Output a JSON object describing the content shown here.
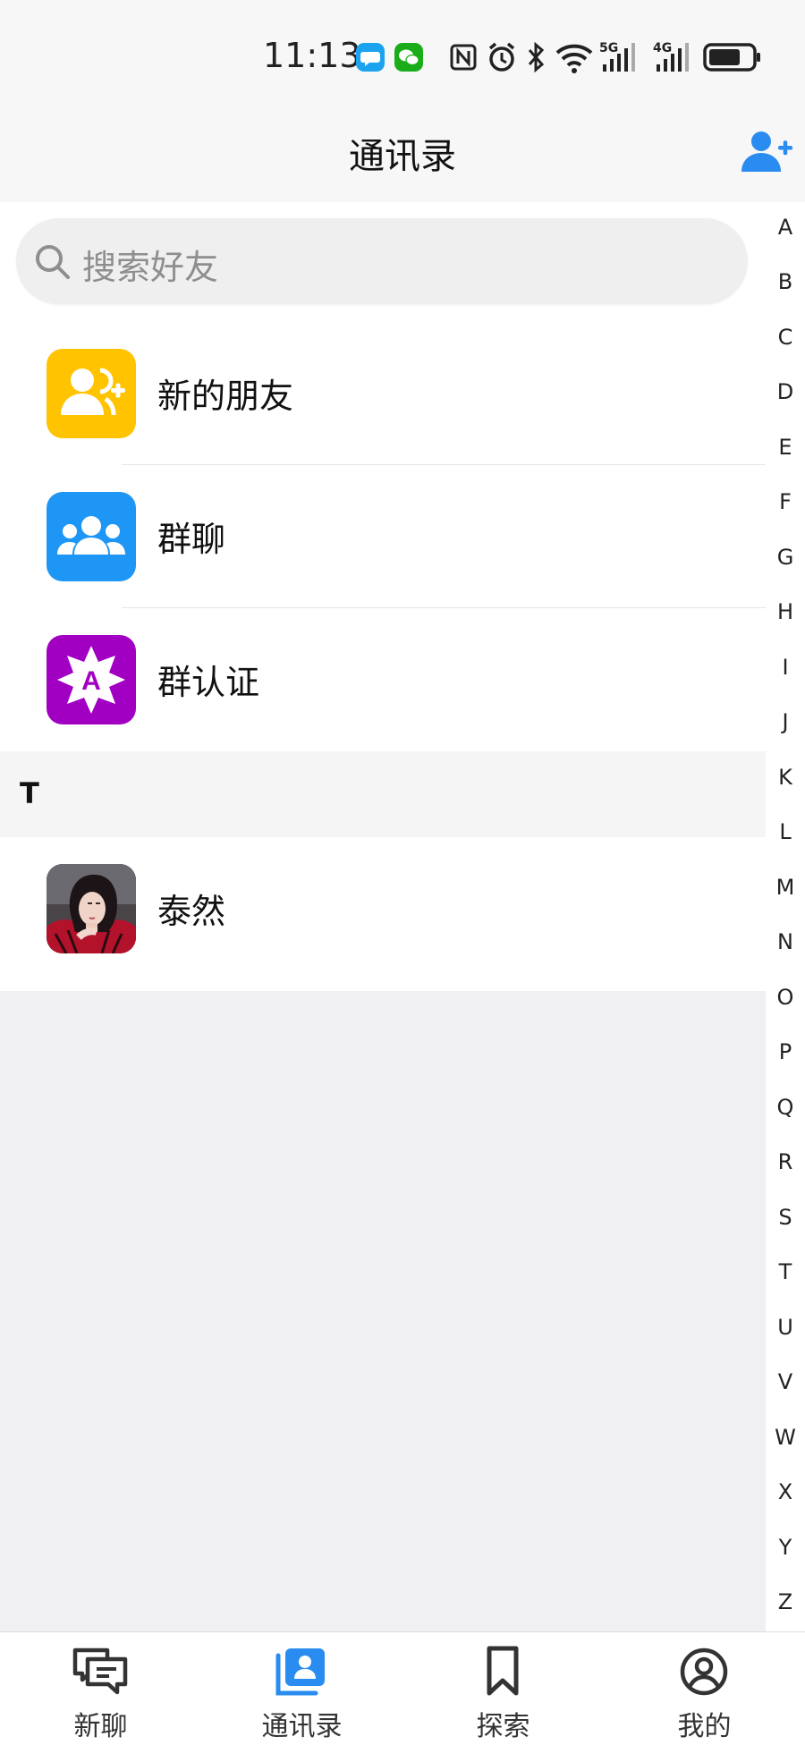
{
  "status_bar": {
    "time": "11:13",
    "network_1": "5G",
    "network_2": "4G"
  },
  "header": {
    "title": "通讯录",
    "add_icon": "add-friend-icon"
  },
  "search": {
    "placeholder": "搜索好友"
  },
  "menu_items": [
    {
      "label": "新的朋友",
      "icon": "new-friend-icon",
      "color": "#FFC300"
    },
    {
      "label": "群聊",
      "icon": "group-chat-icon",
      "color": "#1E96F5"
    },
    {
      "label": "群认证",
      "icon": "group-verify-icon",
      "color": "#A100C2"
    }
  ],
  "sections": [
    {
      "letter": "T",
      "contacts": [
        {
          "name": "泰然"
        }
      ]
    }
  ],
  "index_letters": [
    "A",
    "B",
    "C",
    "D",
    "E",
    "F",
    "G",
    "H",
    "I",
    "J",
    "K",
    "L",
    "M",
    "N",
    "O",
    "P",
    "Q",
    "R",
    "S",
    "T",
    "U",
    "V",
    "W",
    "X",
    "Y",
    "Z"
  ],
  "bottom_nav": [
    {
      "label": "新聊",
      "icon": "chat-icon",
      "active": false
    },
    {
      "label": "通讯录",
      "icon": "contacts-icon",
      "active": true
    },
    {
      "label": "探索",
      "icon": "bookmark-icon",
      "active": false
    },
    {
      "label": "我的",
      "icon": "profile-icon",
      "active": false
    }
  ],
  "colors": {
    "accent": "#2A8CF0",
    "background": "#F0F0F3"
  }
}
